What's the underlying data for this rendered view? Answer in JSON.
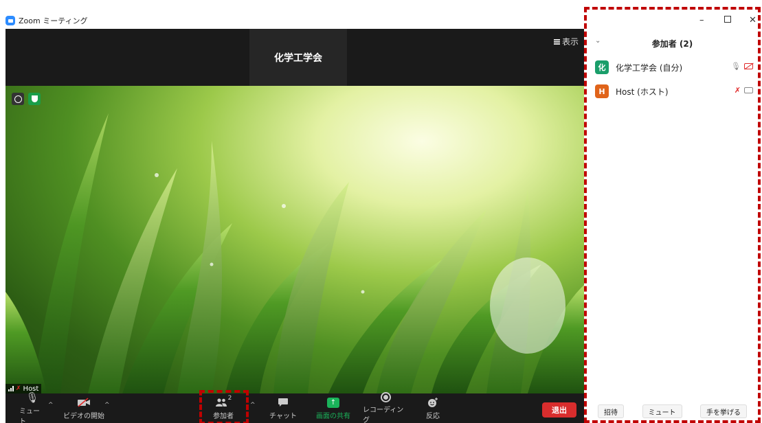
{
  "window": {
    "title": "Zoom ミーティング"
  },
  "topbar": {
    "speaker_name": "化学工学会",
    "view_label": "表示"
  },
  "video": {
    "name_tag": "Host"
  },
  "toolbar": {
    "mute_label": "ミュート",
    "video_label": "ビデオの開始",
    "participants_label": "参加者",
    "participants_count": "2",
    "chat_label": "チャット",
    "share_label": "画面の共有",
    "record_label": "レコーディング",
    "react_label": "反応",
    "leave_label": "退出"
  },
  "panel": {
    "title": "参加者 (2)",
    "participants": [
      {
        "avatar": "化",
        "name": "化学工学会 (自分)",
        "avatar_color": "#1a9e6a"
      },
      {
        "avatar": "H",
        "name": "Host (ホスト)",
        "avatar_color": "#e0641a"
      }
    ],
    "footer": {
      "invite": "招待",
      "mute": "ミュート",
      "raise_hand": "手を挙げる"
    }
  },
  "colors": {
    "accent_red": "#c00000",
    "share_green": "#1ab35a",
    "leave_red": "#d92d2d"
  }
}
